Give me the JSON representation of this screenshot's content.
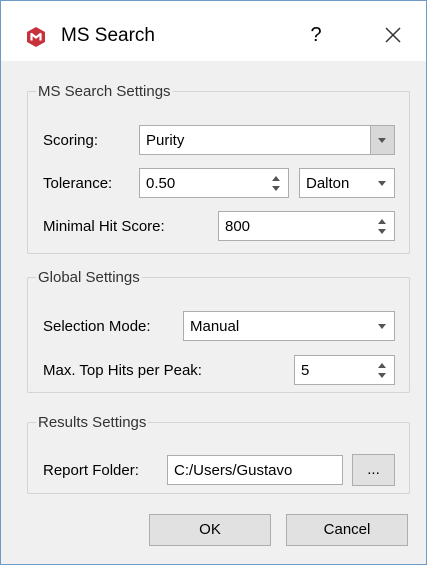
{
  "window": {
    "title": "MS Search",
    "help_label": "?",
    "icons": {
      "app": "app-logo-icon",
      "close": "close-icon"
    },
    "colors": {
      "app_icon": "#c8323c",
      "border": "#6f99c7"
    }
  },
  "ms_search_settings": {
    "legend": "MS Search Settings",
    "scoring": {
      "label": "Scoring:",
      "value": "Purity"
    },
    "tolerance": {
      "label": "Tolerance:",
      "value": "0.50",
      "unit": "Dalton"
    },
    "minimal_hit_score": {
      "label": "Minimal Hit Score:",
      "value": "800"
    }
  },
  "global_settings": {
    "legend": "Global Settings",
    "selection_mode": {
      "label": "Selection Mode:",
      "value": "Manual"
    },
    "max_top_hits": {
      "label": "Max. Top Hits per Peak:",
      "value": "5"
    }
  },
  "results_settings": {
    "legend": "Results Settings",
    "report_folder": {
      "label": "Report Folder:",
      "value": "C:/Users/Gustavo",
      "browse_label": "..."
    }
  },
  "buttons": {
    "ok": "OK",
    "cancel": "Cancel"
  }
}
